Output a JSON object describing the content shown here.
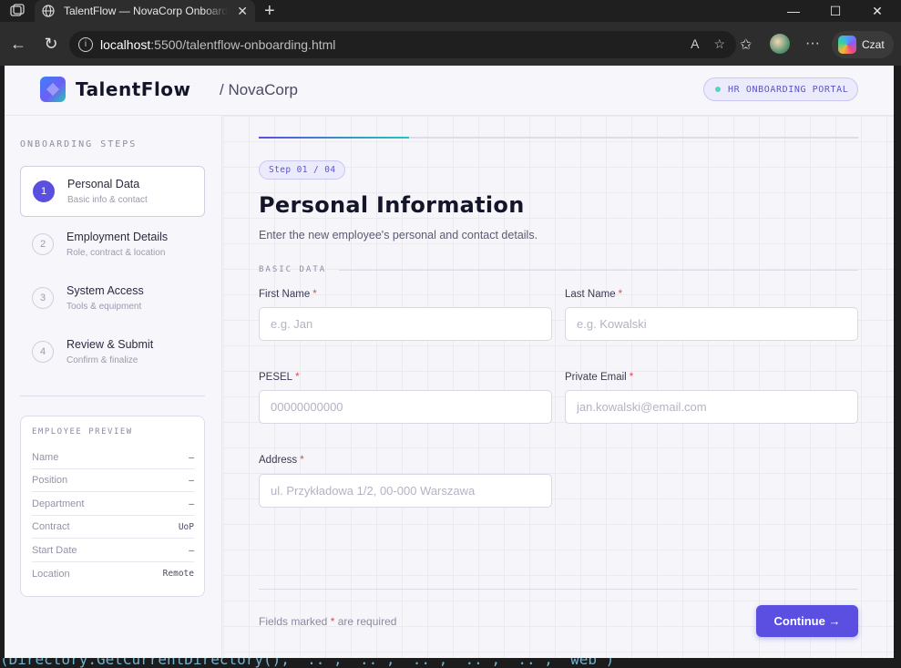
{
  "browser": {
    "tab_title": "TalentFlow — NovaCorp Onboarding",
    "url_host": "localhost",
    "url_path": ":5500/talentflow-onboarding.html",
    "copilot_label": "Czat"
  },
  "header": {
    "brand_name": "TalentFlow",
    "org": "/ NovaCorp",
    "portal_badge": "HR ONBOARDING PORTAL"
  },
  "sidebar": {
    "title": "ONBOARDING STEPS",
    "steps": [
      {
        "num": "1",
        "title": "Personal Data",
        "sub": "Basic info & contact",
        "active": true
      },
      {
        "num": "2",
        "title": "Employment Details",
        "sub": "Role, contract & location"
      },
      {
        "num": "3",
        "title": "System Access",
        "sub": "Tools & equipment"
      },
      {
        "num": "4",
        "title": "Review & Submit",
        "sub": "Confirm & finalize"
      }
    ],
    "preview": {
      "title": "EMPLOYEE PREVIEW",
      "rows": [
        {
          "key": "Name",
          "value": "–"
        },
        {
          "key": "Position",
          "value": "–"
        },
        {
          "key": "Department",
          "value": "–"
        },
        {
          "key": "Contract",
          "value": "UoP"
        },
        {
          "key": "Start Date",
          "value": "–"
        },
        {
          "key": "Location",
          "value": "Remote"
        }
      ]
    }
  },
  "main": {
    "step_badge": "Step 01 / 04",
    "progress": 0.25,
    "heading": "Personal Information",
    "subheading": "Enter the new employee's personal and contact details.",
    "section_label": "BASIC DATA",
    "fields": {
      "first_name": {
        "label": "First Name",
        "placeholder": "e.g. Jan"
      },
      "last_name": {
        "label": "Last Name",
        "placeholder": "e.g. Kowalski"
      },
      "pesel": {
        "label": "PESEL",
        "placeholder": "00000000000"
      },
      "email": {
        "label": "Private Email",
        "placeholder": "jan.kowalski@email.com"
      },
      "address": {
        "label": "Address",
        "placeholder": "ul. Przykładowa 1/2, 00-000 Warszawa"
      }
    },
    "required_mark": "*",
    "required_note_before": "Fields marked ",
    "required_note_after": " are required",
    "continue_label": "Continue →"
  },
  "background_code": "(Directory.GetCurrentDirectory(), \"..\", \"..\", \"..\", \"..\", \"..\", \"web\")"
}
